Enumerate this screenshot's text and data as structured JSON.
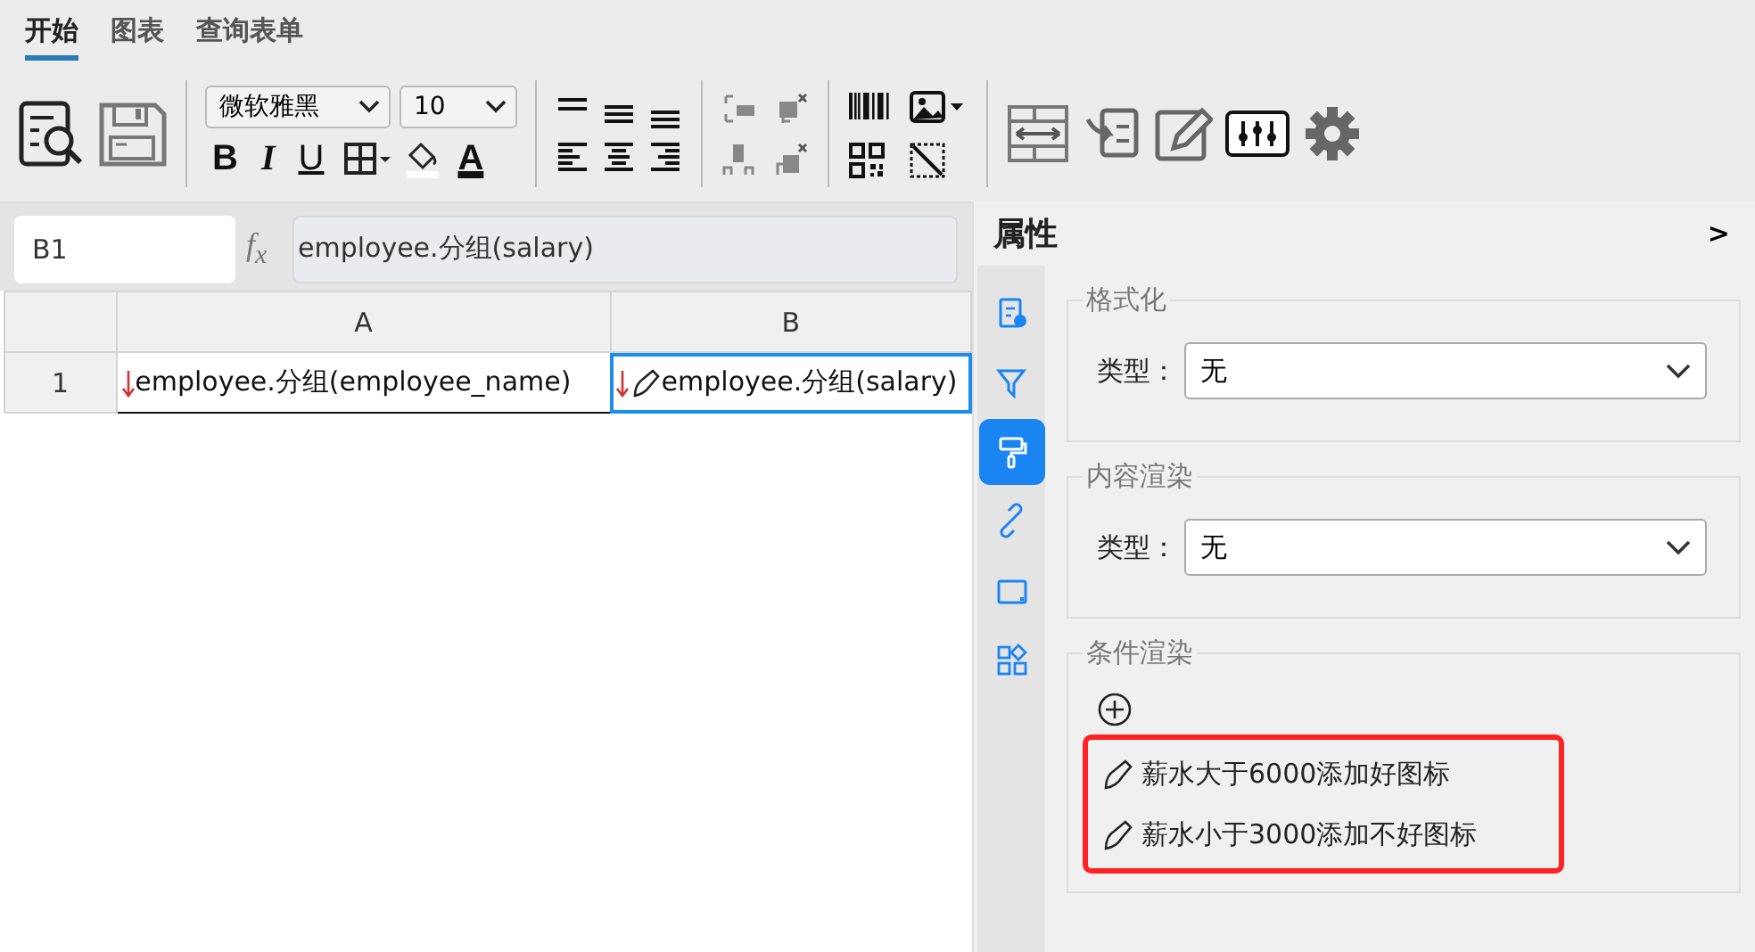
{
  "tabs": [
    {
      "label": "开始",
      "selected": true
    },
    {
      "label": "图表",
      "selected": false
    },
    {
      "label": "查询表单",
      "selected": false
    }
  ],
  "toolbar": {
    "font": "微软雅黑",
    "size": "10",
    "bold": "B",
    "italic": "I",
    "underline": "U",
    "font_color": "A"
  },
  "formula_bar": {
    "cell_ref": "B1",
    "fx": "f$_{x}$",
    "formula": "employee.分组(salary)"
  },
  "grid": {
    "columns": [
      "A",
      "B"
    ],
    "rows": [
      {
        "header": "1",
        "cells": [
          {
            "text": "employee.分组(employee_name)",
            "selected": false,
            "brush": false
          },
          {
            "text": "employee.分组(salary)",
            "selected": true,
            "brush": true
          }
        ]
      }
    ]
  },
  "panel": {
    "title": "属性",
    "collapse": ">",
    "side_tabs": [
      {
        "kind": "doc",
        "selected": false
      },
      {
        "kind": "filter",
        "selected": false
      },
      {
        "kind": "roller",
        "selected": true
      },
      {
        "kind": "link",
        "selected": false
      },
      {
        "kind": "frame",
        "selected": false
      },
      {
        "kind": "widgets",
        "selected": false
      }
    ],
    "sections": [
      {
        "kind": "select",
        "title": "格式化",
        "label": "类型：",
        "value": "无"
      },
      {
        "kind": "select",
        "title": "内容渲染",
        "label": "类型：",
        "value": "无"
      },
      {
        "kind": "rules",
        "title": "条件渲染",
        "highlighted": true,
        "rules": [
          "薪水大于6000添加好图标",
          "薪水小于3000添加不好图标"
        ]
      }
    ]
  }
}
